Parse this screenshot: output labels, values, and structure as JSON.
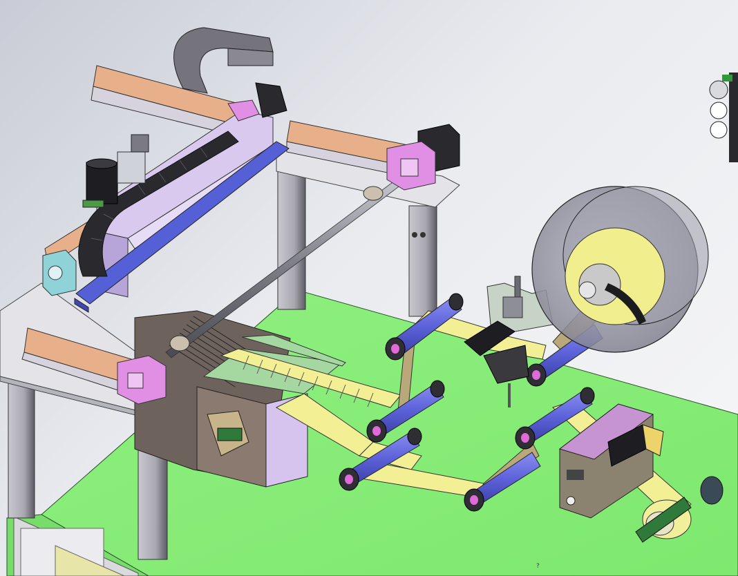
{
  "view": {
    "background_top": "#c9ccd6",
    "background_bottom": "#f7f7f8",
    "annotation_text": "?"
  },
  "colors": {
    "table_green": "#86f07a",
    "rail_orange": "#e8b08a",
    "rail_peach": "#f2c9a5",
    "frame_gray": "#a7a6ae",
    "leg_dark": "#5a5860",
    "plate_light": "#e2e2e6",
    "blue_channel": "#5660d6",
    "roller_blue": "#6b70e6",
    "tape_yellow": "#f3ef95",
    "reel_gray": "#9a9aa6",
    "reel_core_yellow": "#f1ee8e",
    "magenta_block": "#e08fe5",
    "cable_chain": "#2a2a2e",
    "lavender_panel": "#c9b5ec",
    "motor_black": "#1e1e22"
  },
  "components": [
    {
      "name": "gantry-frame-icon"
    },
    {
      "name": "cable-chain-icon"
    },
    {
      "name": "servo-motor-icon"
    },
    {
      "name": "linear-rail-icon"
    },
    {
      "name": "lead-screw-icon"
    },
    {
      "name": "feed-roller-icon"
    },
    {
      "name": "tape-reel-icon"
    },
    {
      "name": "cutter-unit-icon"
    },
    {
      "name": "work-table-icon"
    }
  ]
}
